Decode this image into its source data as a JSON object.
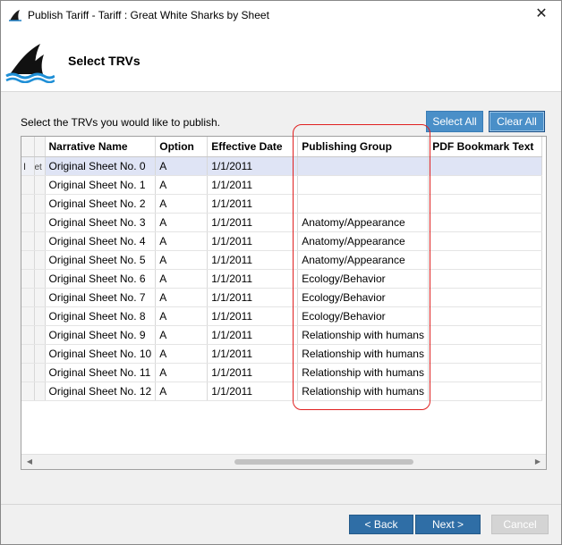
{
  "window": {
    "title": "Publish Tariff - Tariff : Great White Sharks by Sheet",
    "close_glyph": "✕"
  },
  "header": {
    "page_title": "Select TRVs"
  },
  "main": {
    "instruction": "Select the TRVs you would like to publish.",
    "select_all_label": "Select All",
    "clear_all_label": "Clear All"
  },
  "grid": {
    "columns": [
      "Narrative Name",
      "Option",
      "Effective Date",
      "Publishing Group",
      "PDF Bookmark Text"
    ],
    "first_row_marker": "I",
    "first_row_cell_fragment": "et",
    "rows": [
      {
        "name": "Original Sheet No. 0",
        "option": "A",
        "date": "1/1/2011",
        "group": "",
        "bookmark": "",
        "selected": true
      },
      {
        "name": "Original Sheet No. 1",
        "option": "A",
        "date": "1/1/2011",
        "group": "",
        "bookmark": ""
      },
      {
        "name": "Original Sheet No. 2",
        "option": "A",
        "date": "1/1/2011",
        "group": "",
        "bookmark": ""
      },
      {
        "name": "Original Sheet No. 3",
        "option": "A",
        "date": "1/1/2011",
        "group": "Anatomy/Appearance",
        "bookmark": ""
      },
      {
        "name": "Original Sheet No. 4",
        "option": "A",
        "date": "1/1/2011",
        "group": "Anatomy/Appearance",
        "bookmark": ""
      },
      {
        "name": "Original Sheet No. 5",
        "option": "A",
        "date": "1/1/2011",
        "group": "Anatomy/Appearance",
        "bookmark": ""
      },
      {
        "name": "Original Sheet No. 6",
        "option": "A",
        "date": "1/1/2011",
        "group": "Ecology/Behavior",
        "bookmark": ""
      },
      {
        "name": "Original Sheet No. 7",
        "option": "A",
        "date": "1/1/2011",
        "group": "Ecology/Behavior",
        "bookmark": ""
      },
      {
        "name": "Original Sheet No. 8",
        "option": "A",
        "date": "1/1/2011",
        "group": "Ecology/Behavior",
        "bookmark": ""
      },
      {
        "name": "Original Sheet No. 9",
        "option": "A",
        "date": "1/1/2011",
        "group": "Relationship with humans",
        "bookmark": ""
      },
      {
        "name": "Original Sheet No. 10",
        "option": "A",
        "date": "1/1/2011",
        "group": "Relationship with humans",
        "bookmark": ""
      },
      {
        "name": "Original Sheet No. 11",
        "option": "A",
        "date": "1/1/2011",
        "group": "Relationship with humans",
        "bookmark": ""
      },
      {
        "name": "Original Sheet No. 12",
        "option": "A",
        "date": "1/1/2011",
        "group": "Relationship with humans",
        "bookmark": ""
      }
    ]
  },
  "footer": {
    "back_label": "< Back",
    "next_label": "Next >",
    "cancel_label": "Cancel"
  },
  "colors": {
    "accent": "#4a8fc8",
    "footer_button": "#2f6ea6",
    "selected_row": "#dfe4f5",
    "annotation": "#e02020"
  }
}
